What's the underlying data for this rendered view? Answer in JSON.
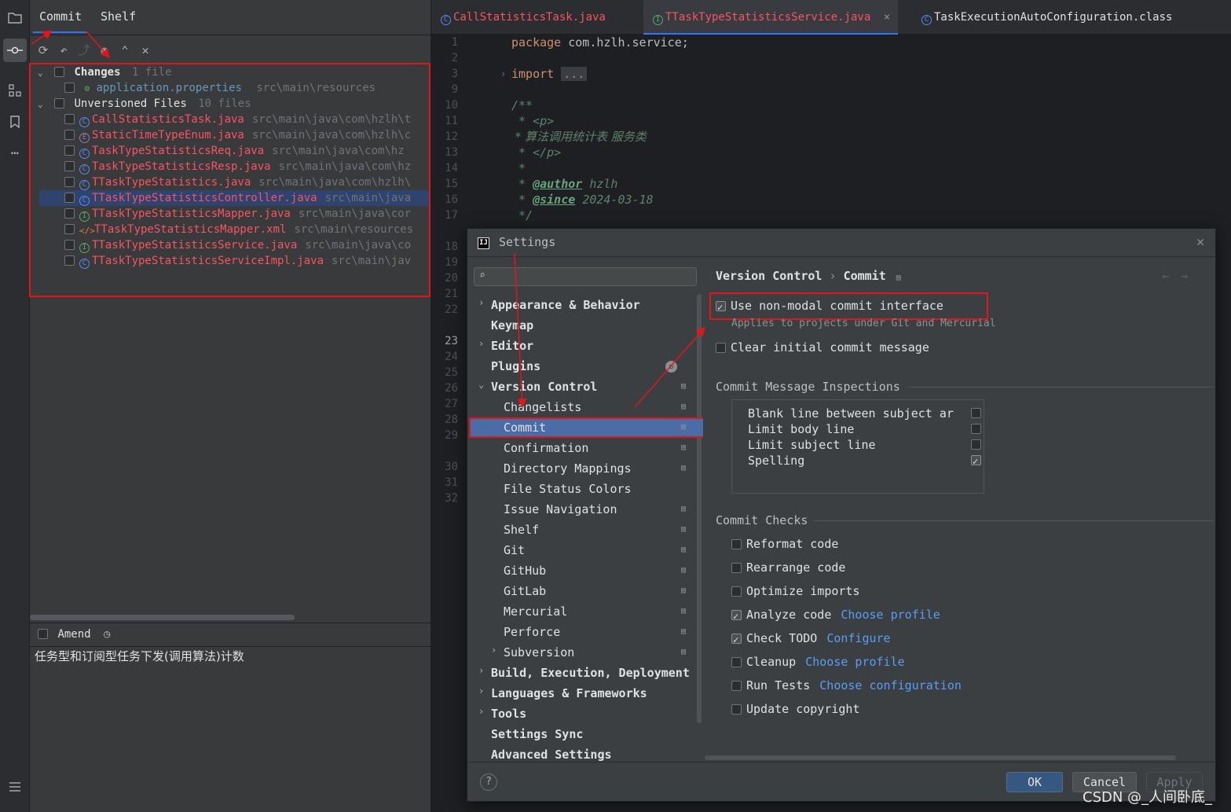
{
  "toolstrip": {
    "icons": [
      "project-icon",
      "commit-icon",
      "structure-icon",
      "bookmarks-icon",
      "more-icon",
      "todo-icon"
    ]
  },
  "commit_panel": {
    "tabs": [
      "Commit",
      "Shelf"
    ],
    "changes": {
      "label": "Changes",
      "count": "1 file",
      "files": [
        {
          "name": "application.properties",
          "path": "src\\main\\resources"
        }
      ]
    },
    "unversioned": {
      "label": "Unversioned Files",
      "count": "10 files",
      "files": [
        {
          "name": "CallStatisticsTask.java",
          "path": "src\\main\\java\\com\\hzlh\\t"
        },
        {
          "name": "StaticTimeTypeEnum.java",
          "path": "src\\main\\java\\com\\hzlh\\c"
        },
        {
          "name": "TaskTypeStatisticsReq.java",
          "path": "src\\main\\java\\com\\hz"
        },
        {
          "name": "TaskTypeStatisticsResp.java",
          "path": "src\\main\\java\\com\\hz"
        },
        {
          "name": "TTaskTypeStatistics.java",
          "path": "src\\main\\java\\com\\hzlh\\"
        },
        {
          "name": "TTaskTypeStatisticsController.java",
          "path": "src\\main\\java"
        },
        {
          "name": "TTaskTypeStatisticsMapper.java",
          "path": "src\\main\\java\\cor"
        },
        {
          "name": "TTaskTypeStatisticsMapper.xml",
          "path": "src\\main\\resources"
        },
        {
          "name": "TTaskTypeStatisticsService.java",
          "path": "src\\main\\java\\co"
        },
        {
          "name": "TTaskTypeStatisticsServiceImpl.java",
          "path": "src\\main\\jav"
        }
      ]
    },
    "amend_label": "Amend",
    "commit_message": "任务型和订阅型任务下发(调用算法)计数"
  },
  "editor": {
    "tabs": [
      {
        "label": "CallStatisticsTask.java"
      },
      {
        "label": "TTaskTypeStatisticsService.java"
      },
      {
        "label": "TaskExecutionAutoConfiguration.class"
      }
    ],
    "close_glyph": "×",
    "line_numbers": [
      "1",
      "2",
      "3",
      "9",
      "10",
      "11",
      "12",
      "13",
      "14",
      "15",
      "16",
      "17",
      "18",
      "19",
      "20",
      "21",
      "22",
      "23",
      "24",
      "25",
      "26",
      "27",
      "28",
      "29",
      "30",
      "31",
      "32"
    ],
    "code": {
      "package_kw": "package",
      "package_name": "com.hzlh.service;",
      "import_kw": "import",
      "import_fold": "...",
      "doc_open": "/**",
      "doc_p_open": " * <p>",
      "doc_desc": " * 算法调用统计表 服务类",
      "doc_p_close": " * </p>",
      "doc_blank": " *",
      "author_tag": "@author",
      "author_val": "hzlh",
      "since_tag": "@since",
      "since_val": "2024-03-18",
      "doc_close": " */"
    }
  },
  "settings": {
    "title": "Settings",
    "search_placeholder": "",
    "nav": [
      {
        "label": "Appearance & Behavior",
        "level": 0,
        "caret": "›"
      },
      {
        "label": "Keymap",
        "level": 0
      },
      {
        "label": "Editor",
        "level": 0,
        "caret": "›"
      },
      {
        "label": "Plugins",
        "level": 0
      },
      {
        "label": "Version Control",
        "level": 0,
        "caret": "⌄"
      },
      {
        "label": "Changelists",
        "level": 1
      },
      {
        "label": "Commit",
        "level": 1
      },
      {
        "label": "Confirmation",
        "level": 1
      },
      {
        "label": "Directory Mappings",
        "level": 1
      },
      {
        "label": "File Status Colors",
        "level": 1
      },
      {
        "label": "Issue Navigation",
        "level": 1
      },
      {
        "label": "Shelf",
        "level": 1
      },
      {
        "label": "Git",
        "level": 1
      },
      {
        "label": "GitHub",
        "level": 1
      },
      {
        "label": "GitLab",
        "level": 1
      },
      {
        "label": "Mercurial",
        "level": 1
      },
      {
        "label": "Perforce",
        "level": 1
      },
      {
        "label": "Subversion",
        "level": 1,
        "caret": "›"
      },
      {
        "label": "Build, Execution, Deployment",
        "level": 0,
        "caret": "›"
      },
      {
        "label": "Languages & Frameworks",
        "level": 0,
        "caret": "›"
      },
      {
        "label": "Tools",
        "level": 0,
        "caret": "›"
      },
      {
        "label": "Settings Sync",
        "level": 0
      },
      {
        "label": "Advanced Settings",
        "level": 0
      }
    ],
    "breadcrumb": {
      "parent": "Version Control",
      "sep": "›",
      "current": "Commit"
    },
    "options": {
      "non_modal": {
        "label": "Use non-modal commit interface",
        "checked": true,
        "hint": "Applies to projects under Git and Mercurial"
      },
      "clear_msg": {
        "label": "Clear initial commit message",
        "checked": false
      }
    },
    "inspections": {
      "title": "Commit Message Inspections",
      "items": [
        {
          "label": "Blank line between subject ar",
          "checked": false
        },
        {
          "label": "Limit body line",
          "checked": false
        },
        {
          "label": "Limit subject line",
          "checked": false
        },
        {
          "label": "Spelling",
          "checked": true
        }
      ]
    },
    "checks": {
      "title": "Commit Checks",
      "items": [
        {
          "label": "Reformat code",
          "checked": false,
          "link": ""
        },
        {
          "label": "Rearrange code",
          "checked": false,
          "link": ""
        },
        {
          "label": "Optimize imports",
          "checked": false,
          "link": ""
        },
        {
          "label": "Analyze code",
          "checked": true,
          "link": "Choose profile"
        },
        {
          "label": "Check TODO",
          "checked": true,
          "link": "Configure"
        },
        {
          "label": "Cleanup",
          "checked": false,
          "link": "Choose profile"
        },
        {
          "label": "Run Tests",
          "checked": false,
          "link": "Choose configuration"
        },
        {
          "label": "Update copyright",
          "checked": false,
          "link": ""
        }
      ]
    },
    "buttons": {
      "ok": "OK",
      "cancel": "Cancel",
      "apply": "Apply"
    },
    "help": "?"
  },
  "watermark": "CSDN @_人间卧底_",
  "colors": {
    "accent": "#3574f0",
    "selection": "#4a6da7",
    "annotation": "#e0161b"
  }
}
